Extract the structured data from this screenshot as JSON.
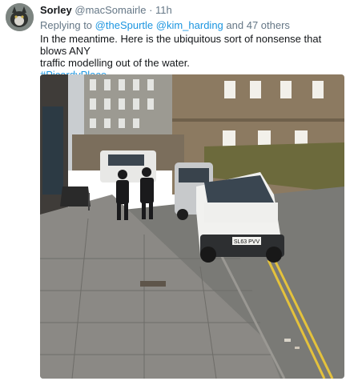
{
  "tweet": {
    "author_name": "Sorley",
    "author_handle": "@macSomairle",
    "separator": "·",
    "time": "11h",
    "reply_prefix": "Replying to",
    "reply_mention_1": "@theSpurtle",
    "reply_mention_2": "@kim_harding",
    "reply_suffix": "and 47 others",
    "text_line_1": "In the meantime. Here is the ubiquitous sort of nonsense that blows ANY",
    "text_line_2": "traffic  modelling out of the water.",
    "hashtag": "#PicardyPlace",
    "photo": {
      "plate": "SL63 PVV"
    }
  },
  "colors": {
    "link": "#1b95e0",
    "muted": "#657786",
    "text": "#14171a"
  }
}
